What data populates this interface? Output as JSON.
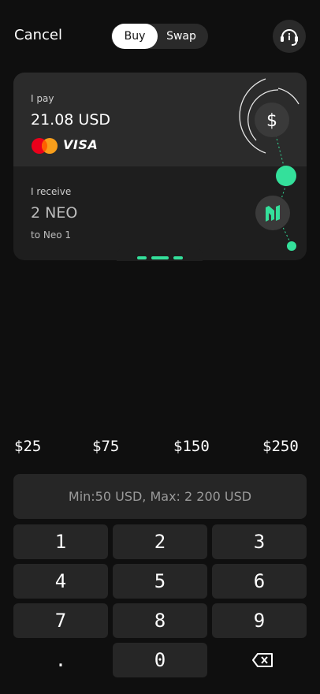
{
  "header": {
    "cancel_label": "Cancel",
    "tabs": [
      {
        "label": "Buy",
        "active": true
      },
      {
        "label": "Swap",
        "active": false
      }
    ],
    "support_icon": "headset-icon"
  },
  "exchange_card": {
    "pay": {
      "label": "I pay",
      "amount": "21.08 USD",
      "methods": [
        "mastercard-logo",
        "VISA"
      ],
      "icon": "dollar-icon"
    },
    "receive": {
      "label": "I receive",
      "amount": "2 NEO",
      "destination": "to Neo 1",
      "icon": "neo-icon"
    },
    "accent_color": "#34e09b"
  },
  "presets": [
    "$25",
    "$75",
    "$150",
    "$250"
  ],
  "limits_text": "Min:50 USD, Max: 2 200 USD",
  "keypad": {
    "keys": [
      "1",
      "2",
      "3",
      "4",
      "5",
      "6",
      "7",
      "8",
      "9",
      ".",
      "0"
    ],
    "backspace_icon": "backspace-icon"
  }
}
